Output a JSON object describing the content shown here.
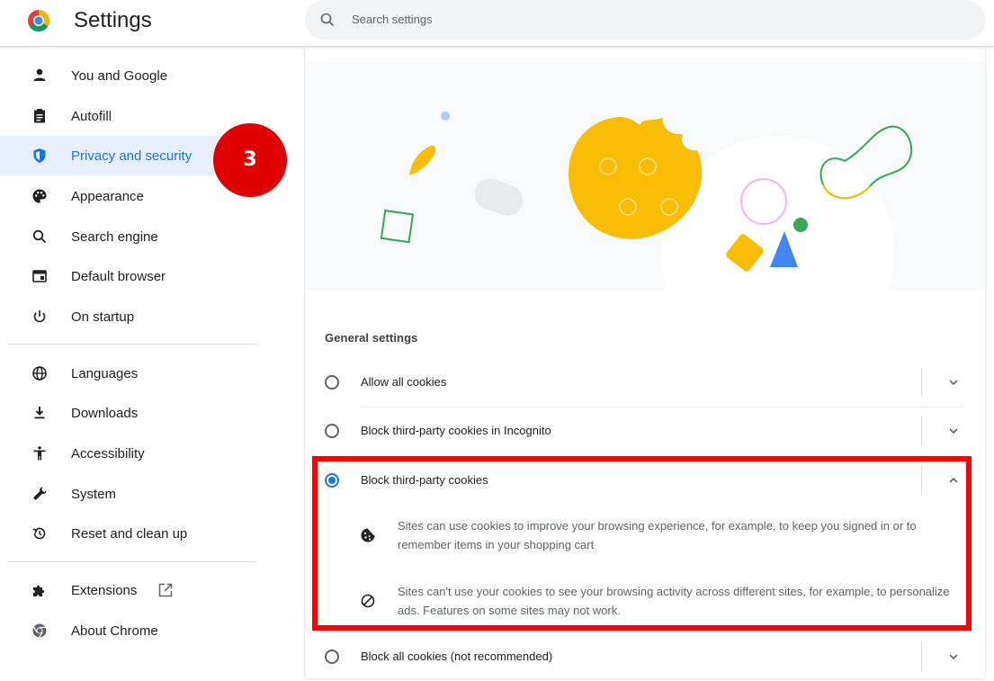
{
  "header": {
    "title": "Settings",
    "search_placeholder": "Search settings",
    "logo_icon": "chrome-logo-icon",
    "search_icon": "search-icon"
  },
  "sidebar": {
    "items": [
      {
        "label": "You and Google",
        "icon": "person-icon"
      },
      {
        "label": "Autofill",
        "icon": "clipboard-icon"
      },
      {
        "label": "Privacy and security",
        "icon": "shield-icon",
        "active": true
      },
      {
        "label": "Appearance",
        "icon": "palette-icon"
      },
      {
        "label": "Search engine",
        "icon": "search-icon"
      },
      {
        "label": "Default browser",
        "icon": "browser-window-icon"
      },
      {
        "label": "On startup",
        "icon": "power-icon"
      },
      {
        "label": "Languages",
        "icon": "globe-icon"
      },
      {
        "label": "Downloads",
        "icon": "download-icon"
      },
      {
        "label": "Accessibility",
        "icon": "accessibility-icon"
      },
      {
        "label": "System",
        "icon": "wrench-icon"
      },
      {
        "label": "Reset and clean up",
        "icon": "restore-icon"
      },
      {
        "label": "Extensions",
        "icon": "puzzle-icon"
      },
      {
        "label": "About Chrome",
        "icon": "chrome-icon"
      }
    ],
    "step_badge": "3"
  },
  "main": {
    "section_title": "General settings",
    "options": [
      {
        "label": "Allow all cookies",
        "selected": false
      },
      {
        "label": "Block third-party cookies in Incognito",
        "selected": false
      },
      {
        "label": "Block third-party cookies",
        "selected": true,
        "expanded": true
      },
      {
        "label": "Block all cookies (not recommended)",
        "selected": false
      }
    ],
    "details": [
      {
        "icon": "cookie-icon",
        "text": "Sites can use cookies to improve your browsing experience, for example, to keep you signed in or to remember items in your shopping cart"
      },
      {
        "icon": "block-icon",
        "text": "Sites can't use your cookies to see your browsing activity across different sites, for example, to personalize ads. Features on some sites may not work."
      }
    ]
  },
  "colors": {
    "accent": "#1a73e8",
    "active_bg": "#e8f0fe",
    "highlight": "#ff0000",
    "badge": "#e00000"
  }
}
